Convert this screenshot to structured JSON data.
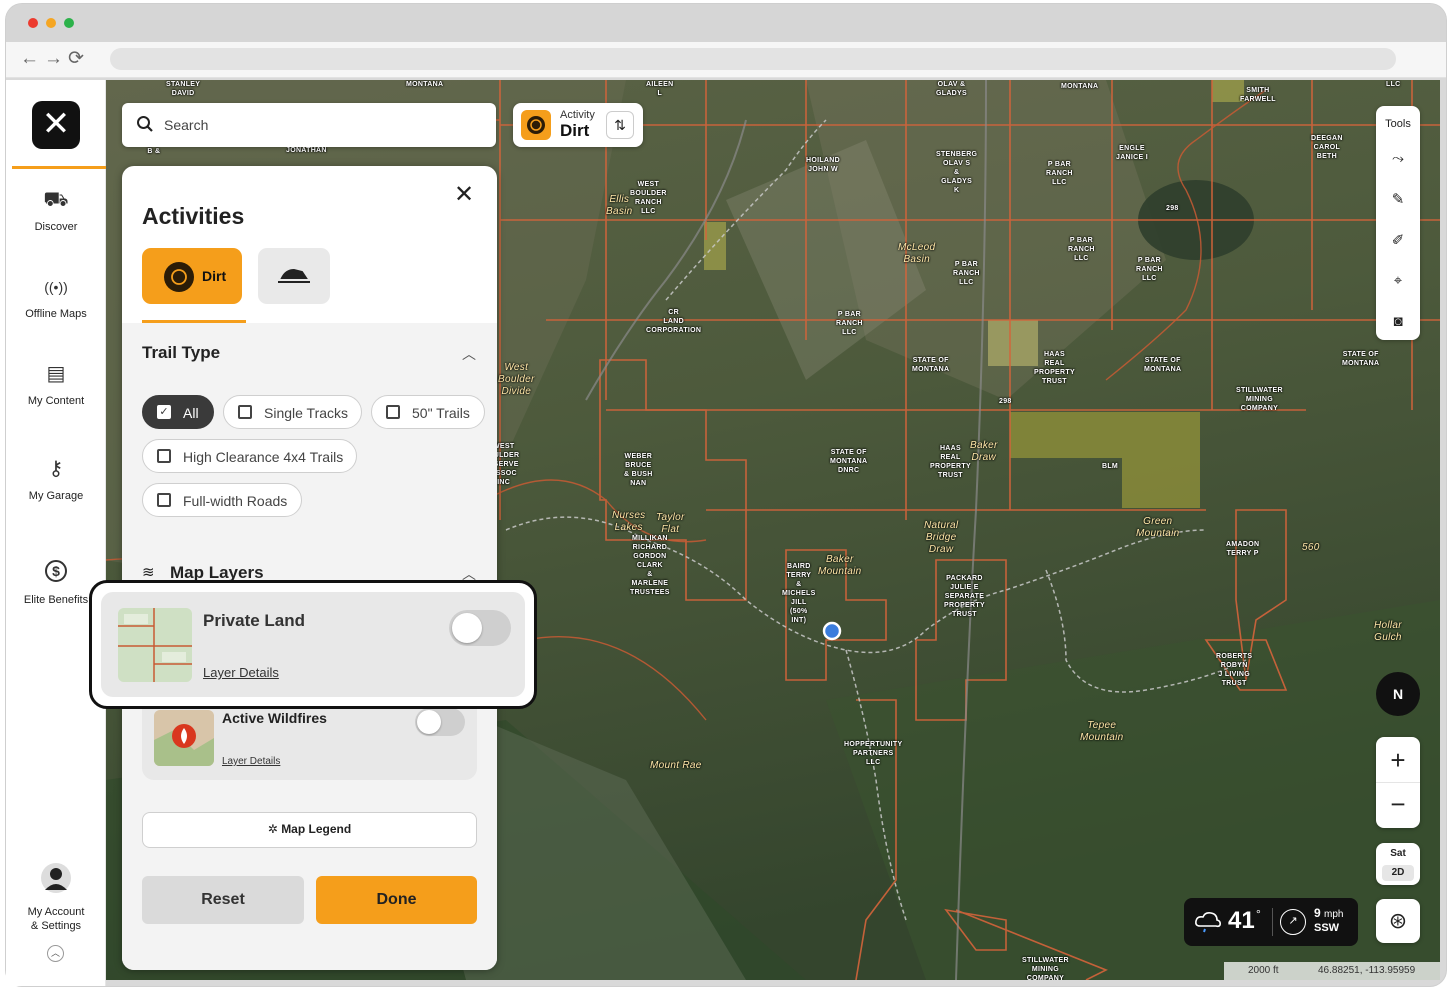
{
  "search": {
    "placeholder": "Search"
  },
  "activity_chip": {
    "label": "Activity",
    "value": "Dirt"
  },
  "sidebar": {
    "items": [
      {
        "label": "Discover"
      },
      {
        "label": "Offline Maps"
      },
      {
        "label": "My Content"
      },
      {
        "label": "My Garage"
      },
      {
        "label": "Elite Benefits"
      }
    ],
    "account_label": "My Account\n& Settings"
  },
  "panel": {
    "title": "Activities",
    "tabs": [
      {
        "label": "Dirt"
      },
      {
        "label": ""
      }
    ],
    "trail_type": {
      "title": "Trail Type",
      "filters": [
        {
          "label": "All",
          "checked": true
        },
        {
          "label": "Single Tracks",
          "checked": false
        },
        {
          "label": "50\" Trails",
          "checked": false
        },
        {
          "label": "High Clearance 4x4 Trails",
          "checked": false
        },
        {
          "label": "Full-width Roads",
          "checked": false
        }
      ]
    },
    "map_layers": {
      "title": "Map Layers",
      "layers": [
        {
          "name": "Private Land",
          "link": "Layer Details",
          "enabled": false
        },
        {
          "name": "Active Wildfires",
          "link": "Layer Details",
          "enabled": false
        }
      ]
    },
    "legend_button": "Map Legend",
    "reset": "Reset",
    "done": "Done"
  },
  "tools": {
    "label": "Tools"
  },
  "compass": "N",
  "map_mode": {
    "mode": "Sat",
    "view": "2D"
  },
  "weather": {
    "temp": "41",
    "deg": "°",
    "speed": "9",
    "unit": "mph",
    "direction": "SSW"
  },
  "scale": {
    "distance": "2000 ft",
    "coords": "46.88251, -113.95959"
  },
  "map_labels": [
    "STANLEY\nDAVID",
    "MONTANA",
    "AILEEN\nL",
    "OLAV &\nGLADYS",
    "MONTANA",
    "SMITH\nFARWELL",
    "LLC",
    "BANNUS\nB &",
    "JONATHAN",
    "HOILAND\nJOHN W",
    "STENBERG\nOLAV S\n&\nGLADYS\nK",
    "P BAR\nRANCH\nLLC",
    "ENGLE\nJANICE I",
    "DEEGAN\nCAROL\nBETH",
    "WEST\nBOULDER\nRANCH\nLLC",
    "P BAR\nRANCH\nLLC",
    "P BAR\nRANCH\nLLC",
    "P BAR\nRANCH\nLLC",
    "CR\nLAND\nCORPORATION",
    "P BAR\nRANCH\nLLC",
    "STATE OF\nMONTANA",
    "HAAS\nREAL\nPROPERTY\nTRUST",
    "STATE OF\nMONTANA",
    "STATE OF\nMONTANA",
    "STILLWATER\nMINING\nCOMPANY",
    "WEST\nOULDER\nESERVE\nASSOC\nINC",
    "WEBER\nBRUCE\n& BUSH\nNAN",
    "STATE OF\nMONTANA\nDNRC",
    "HAAS\nREAL\nPROPERTY\nTRUST",
    "BLM",
    "MILLIKAN\nRICHARD\nGORDON\nCLARK\n&\nMARLENE\nTRUSTEES",
    "BAIRD\nTERRY\n&\nMICHELS\nJILL\n(50%\nINT)",
    "PACKARD\nJULIE E\nSEPARATE\nPROPERTY\nTRUST",
    "AMADON\nTERRY P",
    "ROBERTS\nROBYN\nJ LIVING\nTRUST",
    "HOPPERTUNITY\nPARTNERS\nLLC",
    "STILLWATER\nMINING\nCOMPANY",
    "Ellis\nBasin",
    "McLeod\nBasin",
    "West\nBoulder\nDivide",
    "Baker\nDraw",
    "Taylor\nFlat",
    "Nurses\nLakes",
    "Green\nMountain",
    "Natural\nBridge\nDraw",
    "Baker\nMountain",
    "Tepee\nMountain",
    "Mount Rae",
    "Hollar\nGulch",
    "560",
    "298",
    "298"
  ]
}
